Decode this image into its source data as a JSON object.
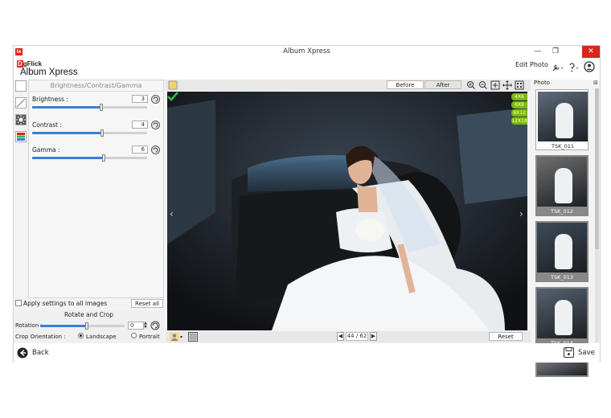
{
  "window": {
    "title": "Album Xpress",
    "icon_label": "Ix",
    "minimize": "—",
    "restore": "❐",
    "close": "✕"
  },
  "header": {
    "brand_d": "D",
    "brand_rest": "gFlick",
    "app_name": "Album Xpress",
    "mode": "Edit Photo"
  },
  "panel": {
    "title": "Brightness/Contrast/Gamma",
    "sliders": [
      {
        "label": "Brightness :",
        "value": "3",
        "level": 0.6
      },
      {
        "label": "Contrast :",
        "value": "4",
        "level": 0.61
      },
      {
        "label": "Gamma :",
        "value": "6",
        "level": 0.62
      }
    ]
  },
  "apply": {
    "label": "Apply settings to all images",
    "reset_all": "Reset all"
  },
  "rotate": {
    "title": "Rotate and Crop",
    "rotation_label": "Rotation :",
    "rotation_value": "0",
    "rotation_level": 0.55,
    "orientation_label": "Crop Orientation :",
    "landscape": "Landscape",
    "portrait": "Portrait",
    "selected": "Landscape"
  },
  "view_toggle": {
    "before": "Before",
    "after": "After",
    "active": "Before"
  },
  "print_sizes": [
    "4X6",
    "6X8",
    "8X12",
    "12X18"
  ],
  "pagination": {
    "text": "44 / 62"
  },
  "image_reset": "Reset",
  "photo_panel": {
    "title": "Photo",
    "items": [
      {
        "caption": "TSK_011",
        "selected": true
      },
      {
        "caption": "TSK_012"
      },
      {
        "caption": "TSK_013"
      },
      {
        "caption": "TSK_014"
      },
      {
        "caption": ""
      }
    ]
  },
  "footer": {
    "back": "Back",
    "save": "Save"
  },
  "colors": {
    "accent": "#3c7fd6",
    "brand_red": "#d9261c",
    "badge_green": "#7ab800",
    "check_green": "#39b54a"
  },
  "icons": [
    "app-icon",
    "wrench-icon",
    "help-icon",
    "user-icon",
    "zoom-in-icon",
    "zoom-out-icon",
    "fit-icon",
    "fullscreen-icon",
    "grid-icon",
    "back-arrow-icon",
    "save-icon",
    "refresh-icon",
    "check-icon"
  ]
}
